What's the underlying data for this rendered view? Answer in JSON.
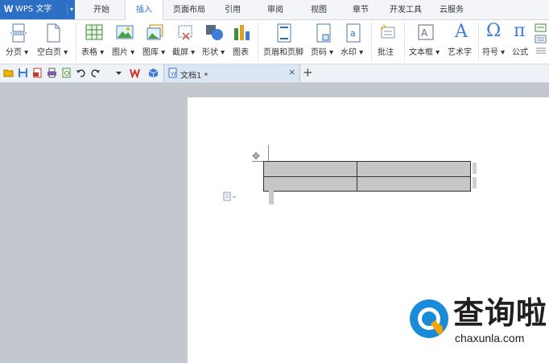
{
  "app": {
    "title": "WPS 文字",
    "logo_letter": "W",
    "caret": "▾"
  },
  "menu_tabs": [
    "开始",
    "插入",
    "页面布局",
    "引用",
    "审阅",
    "视图",
    "章节",
    "开发工具",
    "云服务"
  ],
  "active_tab": "插入",
  "ribbon": {
    "page_break": "分页 ▾",
    "blank_page": "空白页 ▾",
    "table": "表格 ▾",
    "picture": "图片 ▾",
    "gallery": "图库 ▾",
    "screenshot": "截屏 ▾",
    "shape": "形状 ▾",
    "chart": "图表",
    "header_footer": "页眉和页脚",
    "page_number": "页码 ▾",
    "watermark": "水印 ▾",
    "comment": "批注",
    "textbox": "文本框 ▾",
    "wordart": "艺术字",
    "symbol": "符号 ▾",
    "formula": "公式",
    "formula_glyph": "π",
    "symbol_glyph": "Ω",
    "wordart_glyph": "A"
  },
  "document_tab": {
    "name": "文档1 *",
    "close": "×"
  },
  "add_tab": "+",
  "table": {
    "rows": 2,
    "cols": 2
  },
  "watermark": {
    "brand": "查询啦",
    "url": "chaxunla.com"
  },
  "colors": {
    "accent": "#2e6fc6",
    "table_fill": "#c6c6c6",
    "workspace": "#c3c7ce"
  }
}
